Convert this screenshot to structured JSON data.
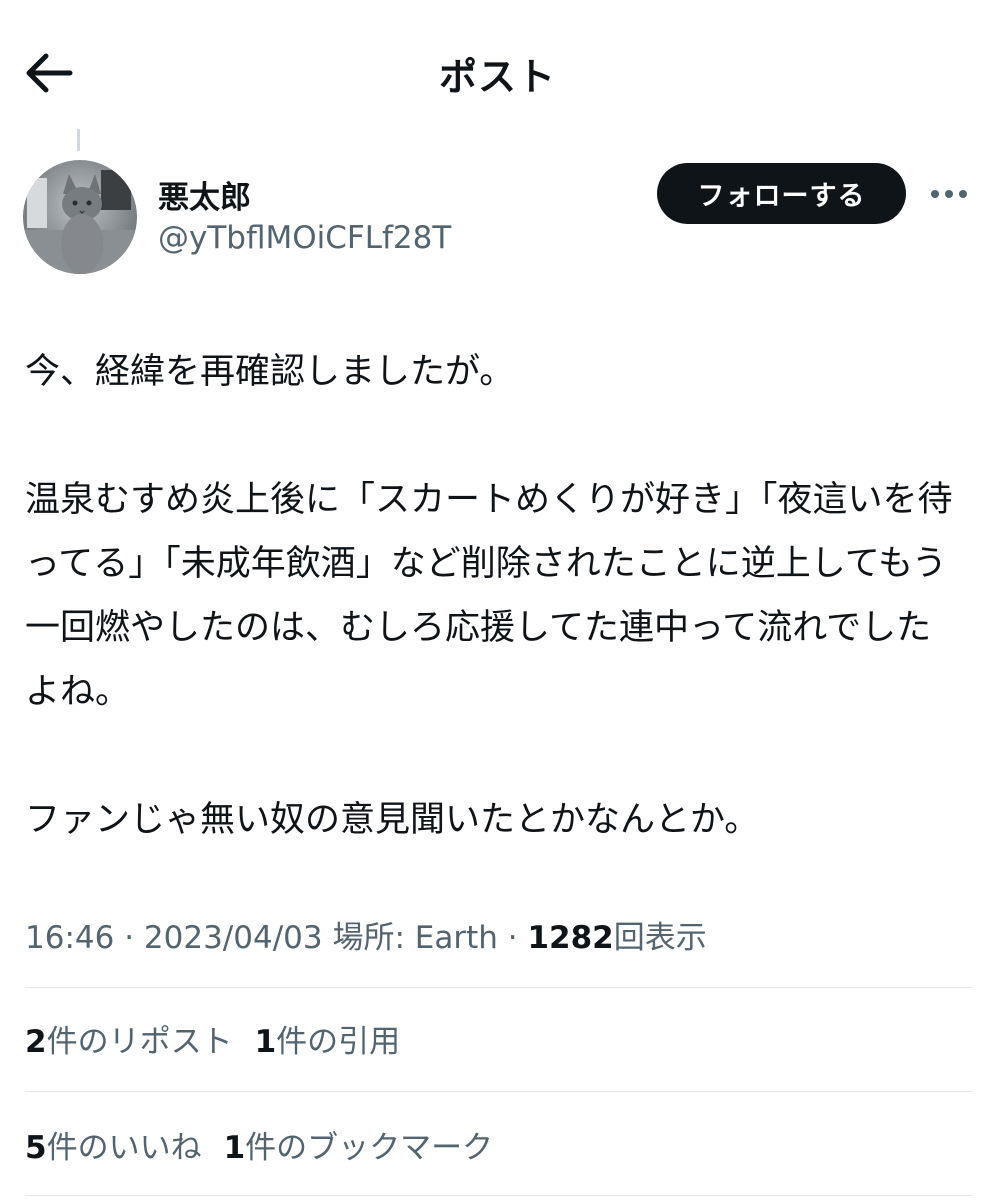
{
  "header": {
    "title": "ポスト",
    "back_icon": "arrow-left-icon"
  },
  "author": {
    "display_name": "悪太郎",
    "handle": "@yTbflMOiCFLf28T",
    "avatar": "cat-photo"
  },
  "follow_button_label": "フォローする",
  "more_icon": "more-horizontal-icon",
  "post": {
    "text": "今、経緯を再確認しましたが。\n\n温泉むすめ炎上後に「スカートめくりが好き」「夜這いを待ってる」「未成年飲酒」など削除されたことに逆上してもう一回燃やしたのは、むしろ応援してた連中って流れでしたよね。\n\nファンじゃ無い奴の意見聞いたとかなんとか。"
  },
  "meta": {
    "time": "16:46",
    "separator": " · ",
    "date": "2023/04/03",
    "location": " 場所: Earth",
    "views_count": "1282",
    "views_label": "回表示"
  },
  "stats": {
    "reposts_count": "2",
    "reposts_label": "件のリポスト",
    "quotes_count": "1",
    "quotes_label": "件の引用",
    "likes_count": "5",
    "likes_label": "件のいいね",
    "bookmarks_count": "1",
    "bookmarks_label": "件のブックマーク"
  },
  "colors": {
    "text_primary": "#0f1419",
    "text_secondary": "#536471",
    "divider": "#e3e7ea",
    "follow_button_bg": "#0f1419"
  }
}
